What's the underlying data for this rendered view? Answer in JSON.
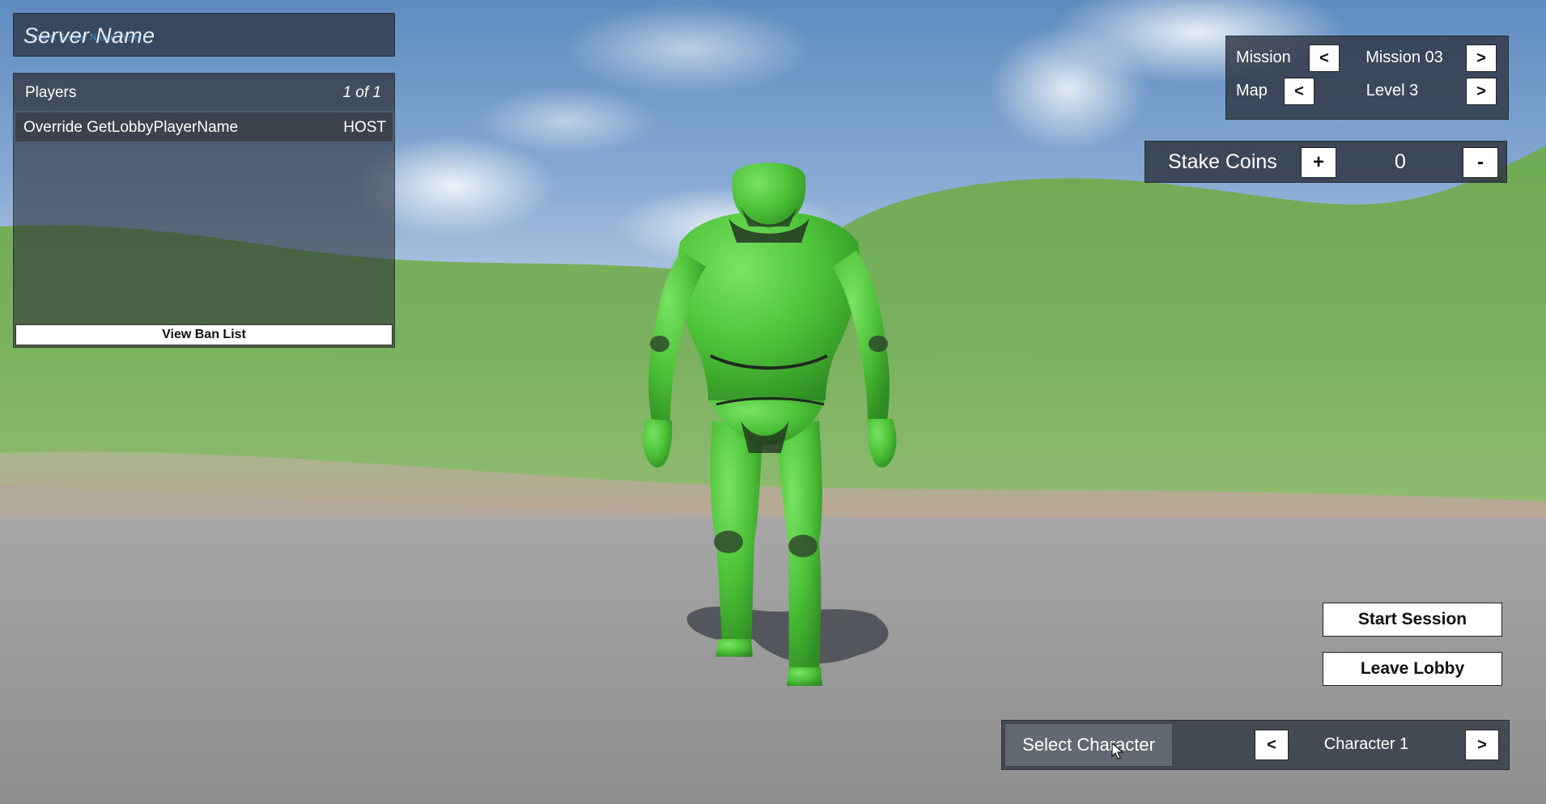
{
  "server": {
    "name": "Server Name",
    "subtitle": "Insert Server Name Here"
  },
  "players_panel": {
    "title": "Players",
    "count": "1 of 1",
    "rows": [
      {
        "name": "Override GetLobbyPlayerName",
        "role": "HOST"
      }
    ],
    "ban_list_button": "View Ban List"
  },
  "mission_panel": {
    "mission_label": "Mission",
    "mission_value": "Mission 03",
    "map_label": "Map",
    "map_value": "Level 3",
    "prev": "<",
    "next": ">"
  },
  "stake": {
    "label": "Stake Coins",
    "plus": "+",
    "value": "0",
    "minus": "-"
  },
  "actions": {
    "start_session": "Start Session",
    "leave_lobby": "Leave Lobby"
  },
  "character_select": {
    "button": "Select Character",
    "prev": "<",
    "value": "Character 1",
    "next": ">"
  },
  "colors": {
    "character_green": "#4fc43a",
    "panel_dark": "#303642",
    "hill_green": "#6fae52"
  }
}
